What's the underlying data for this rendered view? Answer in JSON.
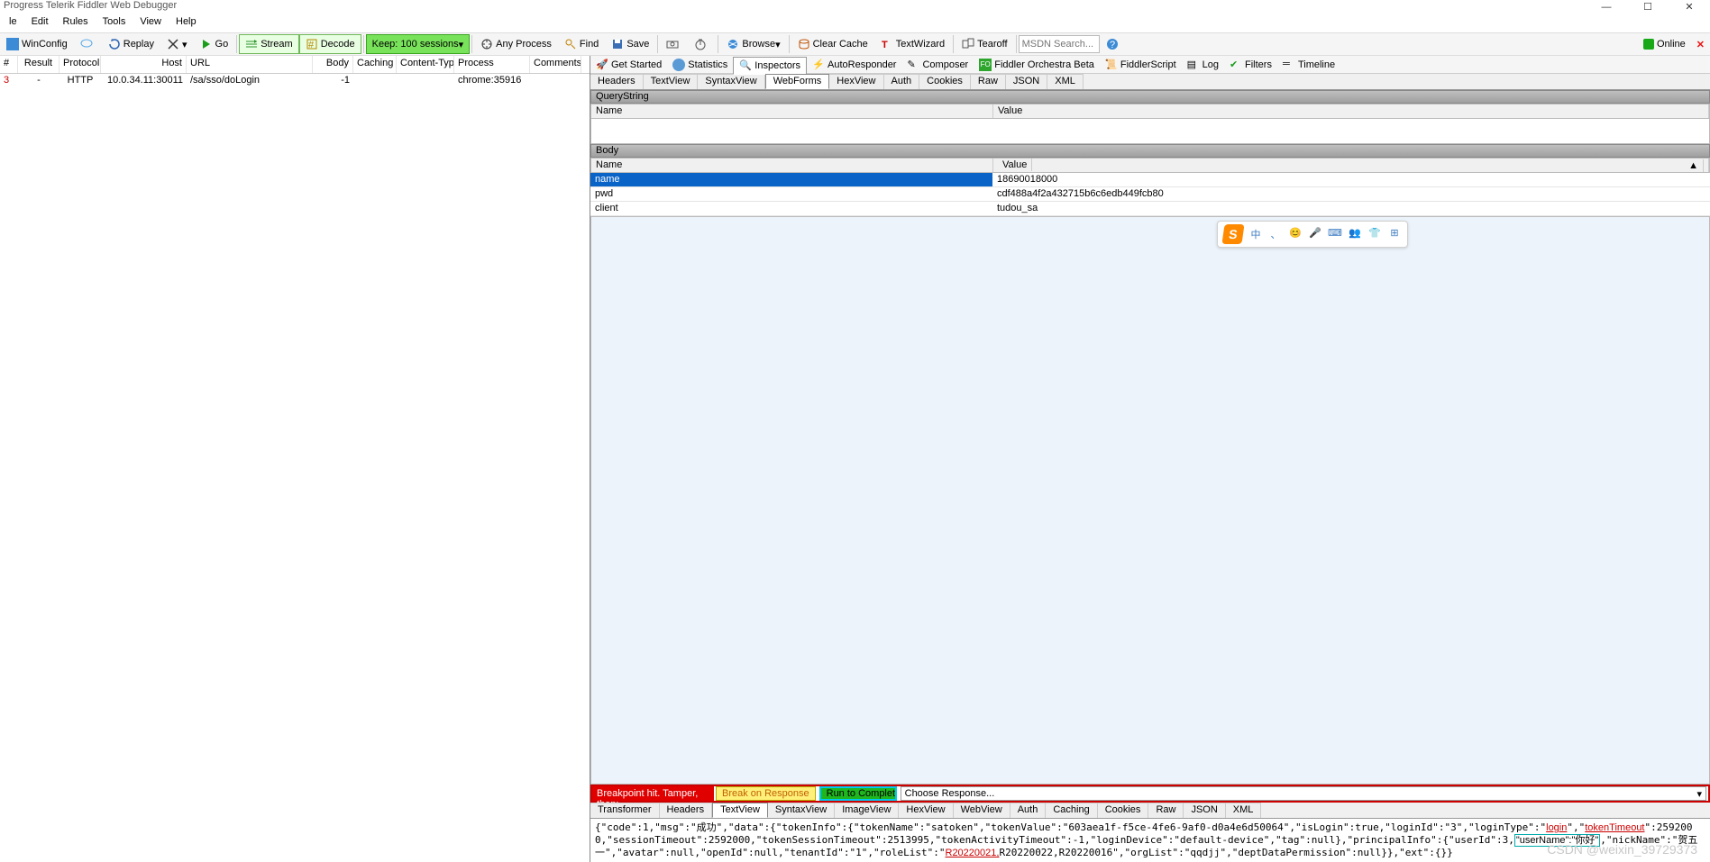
{
  "title": "Progress Telerik Fiddler Web Debugger",
  "menu": [
    "le",
    "Edit",
    "Rules",
    "Tools",
    "View",
    "Help"
  ],
  "toolbar": {
    "winconfig": "WinConfig",
    "replay": "Replay",
    "go": "Go",
    "stream": "Stream",
    "decode": "Decode",
    "keep": "Keep: 100 sessions",
    "anyprocess": "Any Process",
    "find": "Find",
    "save": "Save",
    "browse": "Browse",
    "clearcache": "Clear Cache",
    "textwizard": "TextWizard",
    "tearoff": "Tearoff",
    "search_placeholder": "MSDN Search...",
    "online": "Online"
  },
  "sessions": {
    "cols": [
      "#",
      "Result",
      "Protocol",
      "Host",
      "URL",
      "Body",
      "Caching",
      "Content-Type",
      "Process",
      "Comments"
    ],
    "rows": [
      {
        "num": "3",
        "result": "-",
        "proto": "HTTP",
        "host": "10.0.34.11:30011",
        "url": "/sa/sso/doLogin",
        "body": "-1",
        "cache": "",
        "ctype": "",
        "proc": "chrome:35916",
        "comm": ""
      }
    ]
  },
  "toptabs": [
    "Get Started",
    "Statistics",
    "Inspectors",
    "AutoResponder",
    "Composer",
    "Fiddler Orchestra Beta",
    "FiddlerScript",
    "Log",
    "Filters",
    "Timeline"
  ],
  "reqtabs": [
    "Headers",
    "TextView",
    "SyntaxView",
    "WebForms",
    "HexView",
    "Auth",
    "Cookies",
    "Raw",
    "JSON",
    "XML"
  ],
  "sections": {
    "qs": "QueryString",
    "body": "Body"
  },
  "qshdr": {
    "name": "Name",
    "value": "Value"
  },
  "bodyhdr": {
    "name": "Name",
    "value": "Value"
  },
  "bodyrows": [
    {
      "name": "name",
      "value": "18690018000"
    },
    {
      "name": "pwd",
      "value": "cdf488a4f2a432715b6c6edb449fcb80"
    },
    {
      "name": "client",
      "value": "tudou_sa"
    }
  ],
  "breakpoint": {
    "label": "Breakpoint hit. Tamper, then:",
    "break": "Break on Response",
    "run": "Run to Completion",
    "choose": "Choose Response..."
  },
  "resptabs": [
    "Transformer",
    "Headers",
    "TextView",
    "SyntaxView",
    "ImageView",
    "HexView",
    "WebView",
    "Auth",
    "Caching",
    "Cookies",
    "Raw",
    "JSON",
    "XML"
  ],
  "responseText": "{\"code\":1,\"msg\":\"成功\",\"data\":{\"tokenInfo\":{\"tokenName\":\"satoken\",\"tokenValue\":\"603aea1f-f5ce-4fe6-9af0-d0a4e6d50064\",\"isLogin\":true,\"loginId\":\"3\",\"loginType\":\"login\",\"tokenTimeout\":2592000,\"sessionTimeout\":2592000,\"tokenSessionTimeout\":2513995,\"tokenActivityTimeout\":-1,\"loginDevice\":\"default-device\",\"tag\":null},\"principalInfo\":{\"userId\":3,\"userName\":\"你好\",\"nickName\":\"贺五一\",\"avatar\":null,\"openId\":null,\"tenantId\":\"1\",\"roleList\":\"R20220021,R20220022,R20220016\",\"orgList\":\"qqdjj\",\"deptDataPermission\":null}},\"ext\":{}}",
  "ime": [
    "中",
    "、",
    "😊",
    "🎤",
    "⌨",
    "👥",
    "👕",
    "⊞"
  ],
  "watermark": "CSDN @weixin_39729373"
}
